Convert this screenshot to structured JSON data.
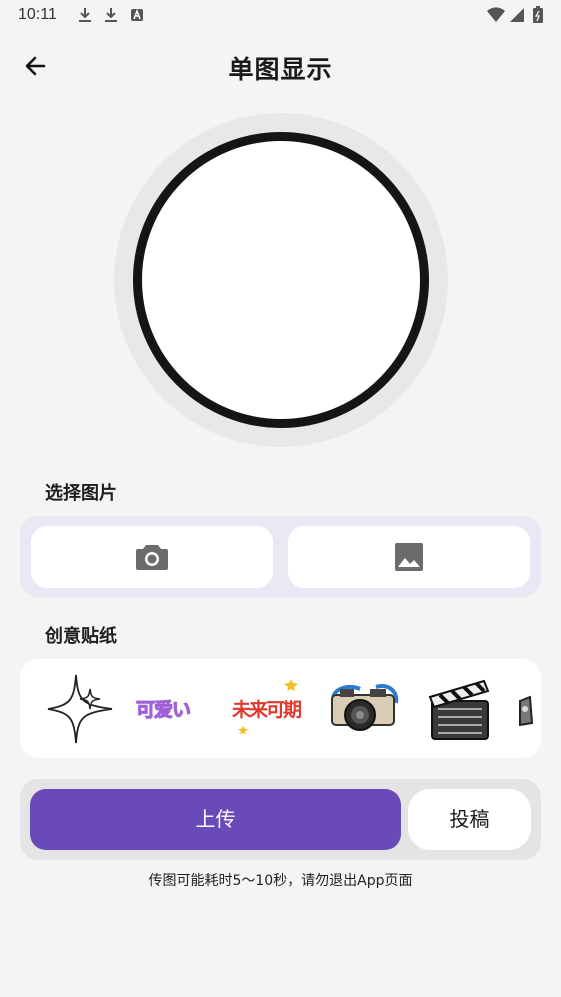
{
  "status_bar": {
    "time": "10:11"
  },
  "header": {
    "title": "单图显示"
  },
  "select_image": {
    "label": "选择图片",
    "camera_icon": "camera-icon",
    "gallery_icon": "image-icon"
  },
  "stickers": {
    "label": "创意贴纸",
    "items": [
      {
        "name": "sparkle-sticker"
      },
      {
        "name": "cute-text-sticker",
        "text": "可爱い"
      },
      {
        "name": "looking-forward-text-sticker",
        "text": "未来可期"
      },
      {
        "name": "camera-sticker"
      },
      {
        "name": "clapperboard-sticker"
      },
      {
        "name": "partial-sticker"
      }
    ]
  },
  "actions": {
    "upload_label": "上传",
    "submit_label": "投稿",
    "upload_color": "#6a4ab8"
  },
  "note": "传图可能耗时5～10秒，请勿退出App页面"
}
